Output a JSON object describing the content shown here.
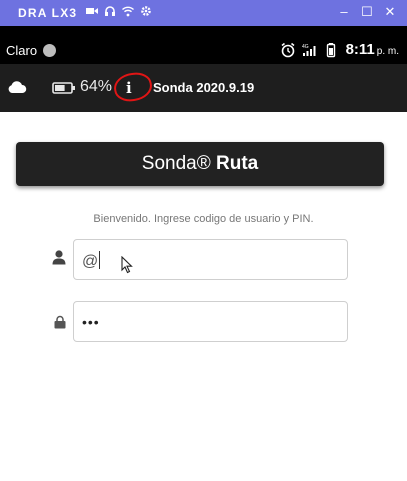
{
  "window": {
    "title": "DRA LX3",
    "icons": [
      "video-icon",
      "headphones-icon",
      "wifi-icon",
      "settings-icon"
    ],
    "controls": {
      "minimize": "–",
      "maximize": "☐",
      "close": "✕"
    }
  },
  "status_bar": {
    "carrier": "Claro",
    "time": "8:11",
    "ampm": "p. m."
  },
  "app_bar": {
    "battery_percent": "64%",
    "info_glyph": "i",
    "version": "Sonda 2020.9.19",
    "battery_level": 0.64
  },
  "banner": {
    "brand": "Sonda®",
    "title": "Ruta"
  },
  "login": {
    "welcome": "Bienvenido. Ingrese codigo de usuario y PIN.",
    "user_value": "@",
    "pin_value": "•••"
  },
  "colors": {
    "window_bar": "#6e72e0",
    "app_bar": "#1e1e1e",
    "banner": "#222222",
    "annotation_circle": "#e01515"
  }
}
